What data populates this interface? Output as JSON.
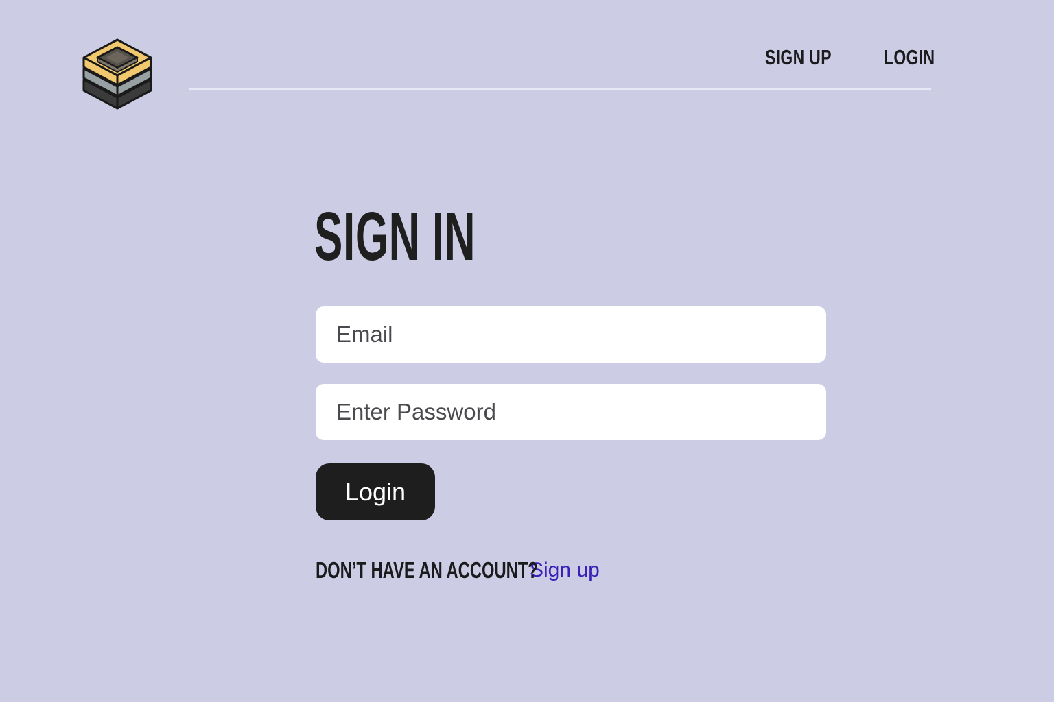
{
  "header": {
    "logo_icon": "stacked-boxes-logo-icon",
    "nav": {
      "signup_label": "SIGN UP",
      "login_label": "LOGIN"
    }
  },
  "main": {
    "title": "SIGN IN",
    "email_placeholder": "Email",
    "password_placeholder": "Enter Password",
    "login_button_label": "Login",
    "footer": {
      "question": "DON’T HAVE AN ACCOUNT?",
      "signup_link": "Sign up"
    }
  },
  "colors": {
    "background": "#cccce5",
    "button": "#1e1e1e",
    "link": "#3a1fb8",
    "logo_accent": "#f2c86f"
  }
}
